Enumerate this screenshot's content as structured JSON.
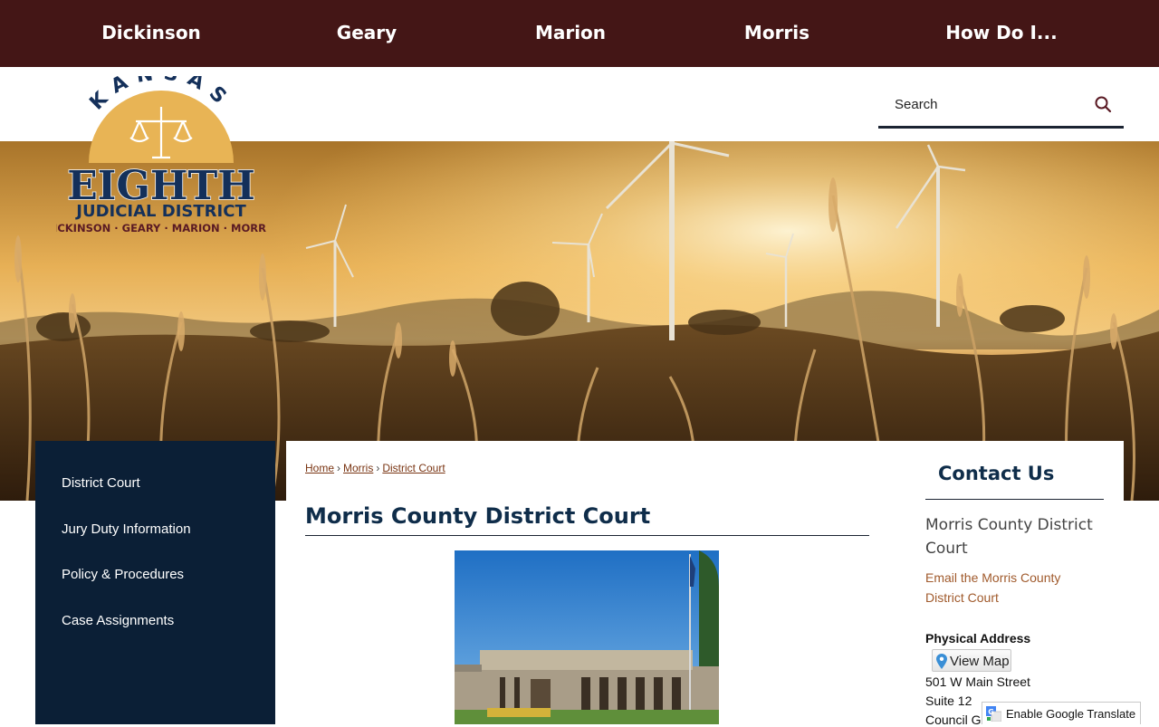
{
  "topnav": {
    "items": [
      {
        "label": "Dickinson"
      },
      {
        "label": "Geary"
      },
      {
        "label": "Marion"
      },
      {
        "label": "Morris"
      },
      {
        "label": "How Do I..."
      }
    ]
  },
  "logo": {
    "arc_text": "KANSAS",
    "main_text": "EIGHTH",
    "sub_text": "JUDICIAL DISTRICT",
    "counties_text": "DICKINSON · GEARY · MARION · MORRIS"
  },
  "search": {
    "placeholder": "Search",
    "value": ""
  },
  "sidebar": {
    "items": [
      {
        "label": "District Court"
      },
      {
        "label": "Jury Duty Information"
      },
      {
        "label": "Policy & Procedures"
      },
      {
        "label": "Case Assignments"
      }
    ]
  },
  "breadcrumb": {
    "home": "Home",
    "morris": "Morris",
    "current": "District Court",
    "separator": "›"
  },
  "main": {
    "title": "Morris County District Court"
  },
  "contact": {
    "title": "Contact Us",
    "name": "Morris County District Court",
    "email_link": "Email the Morris County District Court",
    "address_label": "Physical Address",
    "view_map": "View Map",
    "address_lines": [
      "501 W Main Street",
      "Suite 12",
      "Council G"
    ]
  },
  "translate": {
    "label": "Enable Google Translate"
  },
  "colors": {
    "topnav_bg": "#441616",
    "sidebar_bg": "#0b1f36",
    "title_color": "#0f2d4a",
    "link_color": "#a05a2c",
    "logo_navy": "#14305a",
    "logo_gold": "#e8b455",
    "logo_maroon": "#5a1a24"
  }
}
